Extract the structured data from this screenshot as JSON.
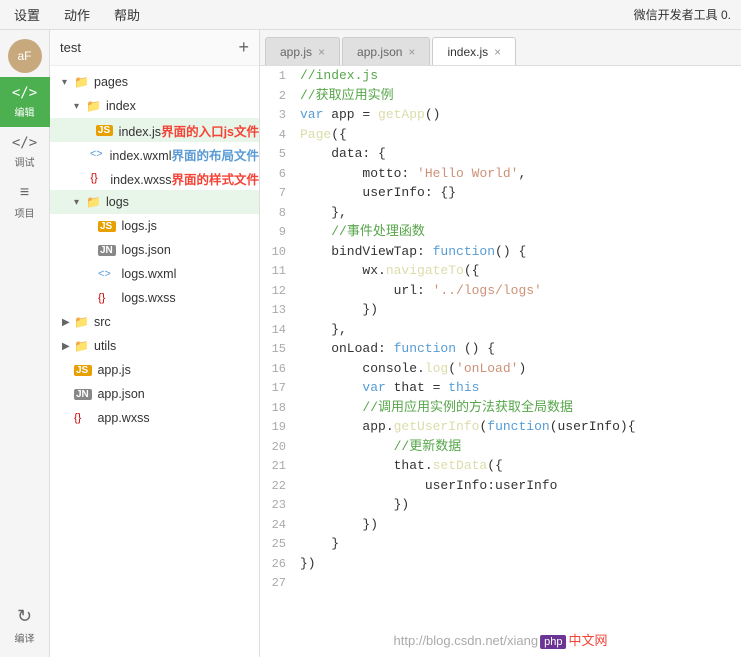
{
  "menubar": {
    "items": [
      "设置",
      "动作",
      "帮助"
    ],
    "right_label": "微信开发者工具 0."
  },
  "sidebar": {
    "items": [
      {
        "id": "avatar",
        "label": "aF",
        "active": false
      },
      {
        "id": "edit",
        "label": "编辑",
        "symbol": "⟨/⟩",
        "active": true
      },
      {
        "id": "debug",
        "label": "调试",
        "symbol": "⟨/⟩",
        "active": false
      },
      {
        "id": "project",
        "label": "项目",
        "symbol": "≡",
        "active": false
      }
    ],
    "bottom": [
      {
        "id": "compile",
        "label": "编译",
        "symbol": "↻"
      }
    ]
  },
  "filetree": {
    "title": "test",
    "add_label": "+",
    "nodes": [
      {
        "id": "pages-folder",
        "indent": 0,
        "arrow": "▾",
        "icon": "📁",
        "icon_class": "folder-color",
        "label": "pages",
        "label_class": ""
      },
      {
        "id": "index-folder",
        "indent": 1,
        "arrow": "▾",
        "icon": "📁",
        "icon_class": "folder-color",
        "label": "index",
        "label_class": ""
      },
      {
        "id": "index-js",
        "indent": 2,
        "arrow": " ",
        "icon": "JS",
        "icon_class": "js-color",
        "label": "index.js",
        "label_suffix": "界面的入口js文件",
        "label_class": "label-js",
        "selected": true
      },
      {
        "id": "index-wxml",
        "indent": 2,
        "arrow": " ",
        "icon": "⟨⟩",
        "icon_class": "wxml-color",
        "label": "index.wxml",
        "label_suffix": "界面的布局文件",
        "label_class": "label-wxml"
      },
      {
        "id": "index-wxss",
        "indent": 2,
        "arrow": " ",
        "icon": "{}",
        "icon_class": "wxss-color",
        "label": "index.wxss",
        "label_suffix": "界面的样式文件",
        "label_class": "label-wxss"
      },
      {
        "id": "logs-folder",
        "indent": 1,
        "arrow": "▾",
        "icon": "📁",
        "icon_class": "folder-color",
        "label": "logs",
        "label_class": ""
      },
      {
        "id": "logs-js",
        "indent": 2,
        "arrow": " ",
        "icon": "JS",
        "icon_class": "js-color",
        "label": "logs.js",
        "label_class": ""
      },
      {
        "id": "logs-json",
        "indent": 2,
        "arrow": " ",
        "icon": "JN",
        "icon_class": "json-color",
        "label": "logs.json",
        "label_class": ""
      },
      {
        "id": "logs-wxml",
        "indent": 2,
        "arrow": " ",
        "icon": "⟨⟩",
        "icon_class": "wxml-color",
        "label": "logs.wxml",
        "label_class": ""
      },
      {
        "id": "logs-wxss",
        "indent": 2,
        "arrow": " ",
        "icon": "{}",
        "icon_class": "wxss-color",
        "label": "logs.wxss",
        "label_class": ""
      },
      {
        "id": "src-folder",
        "indent": 0,
        "arrow": "▶",
        "icon": "📁",
        "icon_class": "folder-color",
        "label": "src",
        "label_class": ""
      },
      {
        "id": "utils-folder",
        "indent": 0,
        "arrow": "▶",
        "icon": "📁",
        "icon_class": "folder-color",
        "label": "utils",
        "label_class": ""
      },
      {
        "id": "app-js",
        "indent": 0,
        "arrow": " ",
        "icon": "JS",
        "icon_class": "js-color",
        "label": "app.js",
        "label_class": ""
      },
      {
        "id": "app-json",
        "indent": 0,
        "arrow": " ",
        "icon": "JN",
        "icon_class": "json-color",
        "label": "app.json",
        "label_class": ""
      },
      {
        "id": "app-wxss",
        "indent": 0,
        "arrow": " ",
        "icon": "{}",
        "icon_class": "wxss-color",
        "label": "app.wxss",
        "label_class": ""
      }
    ]
  },
  "editor": {
    "tabs": [
      {
        "id": "app-js-tab",
        "label": "app.js",
        "active": false,
        "show_close": true
      },
      {
        "id": "app-json-tab",
        "label": "app.json",
        "active": false,
        "show_close": true
      },
      {
        "id": "index-js-tab",
        "label": "index.js",
        "active": true,
        "show_close": true
      }
    ],
    "lines": [
      {
        "num": 1,
        "html": "<span class='c-comment'>//index.js</span>"
      },
      {
        "num": 2,
        "html": "<span class='c-comment'>//获取应用实例</span>"
      },
      {
        "num": 3,
        "html": "<span class='c-keyword'>var</span> app = <span class='c-func'>getApp</span>()"
      },
      {
        "num": 4,
        "html": "<span class='c-func'>Page</span>({"
      },
      {
        "num": 5,
        "html": "    data: {"
      },
      {
        "num": 6,
        "html": "        motto: <span class='c-string'>'Hello World'</span>,"
      },
      {
        "num": 7,
        "html": "        userInfo: {}"
      },
      {
        "num": 8,
        "html": "    },"
      },
      {
        "num": 9,
        "html": "    <span class='c-comment'>//事件处理函数</span>"
      },
      {
        "num": 10,
        "html": "    bindViewTap: <span class='c-keyword'>function</span>() {"
      },
      {
        "num": 11,
        "html": "        wx.<span class='c-func'>navigateTo</span>({"
      },
      {
        "num": 12,
        "html": "            url: <span class='c-string'>'../logs/logs'</span>"
      },
      {
        "num": 13,
        "html": "        })"
      },
      {
        "num": 14,
        "html": "    },"
      },
      {
        "num": 15,
        "html": "    onLoad: <span class='c-keyword'>function</span> () {"
      },
      {
        "num": 16,
        "html": "        console.<span class='c-func'>log</span>(<span class='c-string'>'onLoad'</span>)"
      },
      {
        "num": 17,
        "html": "        <span class='c-keyword'>var</span> that = <span class='c-keyword'>this</span>"
      },
      {
        "num": 18,
        "html": "        <span class='c-comment'>//调用应用实例的方法获取全局数据</span>"
      },
      {
        "num": 19,
        "html": "        app.<span class='c-func'>getUserInfo</span>(<span class='c-keyword'>function</span>(userInfo){"
      },
      {
        "num": 20,
        "html": "            <span class='c-comment'>//更新数据</span>"
      },
      {
        "num": 21,
        "html": "            that.<span class='c-func'>setData</span>({"
      },
      {
        "num": 22,
        "html": "                userInfo:userInfo"
      },
      {
        "num": 23,
        "html": "            })"
      },
      {
        "num": 24,
        "html": "        })"
      },
      {
        "num": 25,
        "html": "    }"
      },
      {
        "num": 26,
        "html": "})"
      },
      {
        "num": 27,
        "html": ""
      }
    ]
  },
  "watermark": {
    "text_before": "http://blog.csdn.net/xiang",
    "php_badge": "php",
    "text_after": "中文网"
  }
}
